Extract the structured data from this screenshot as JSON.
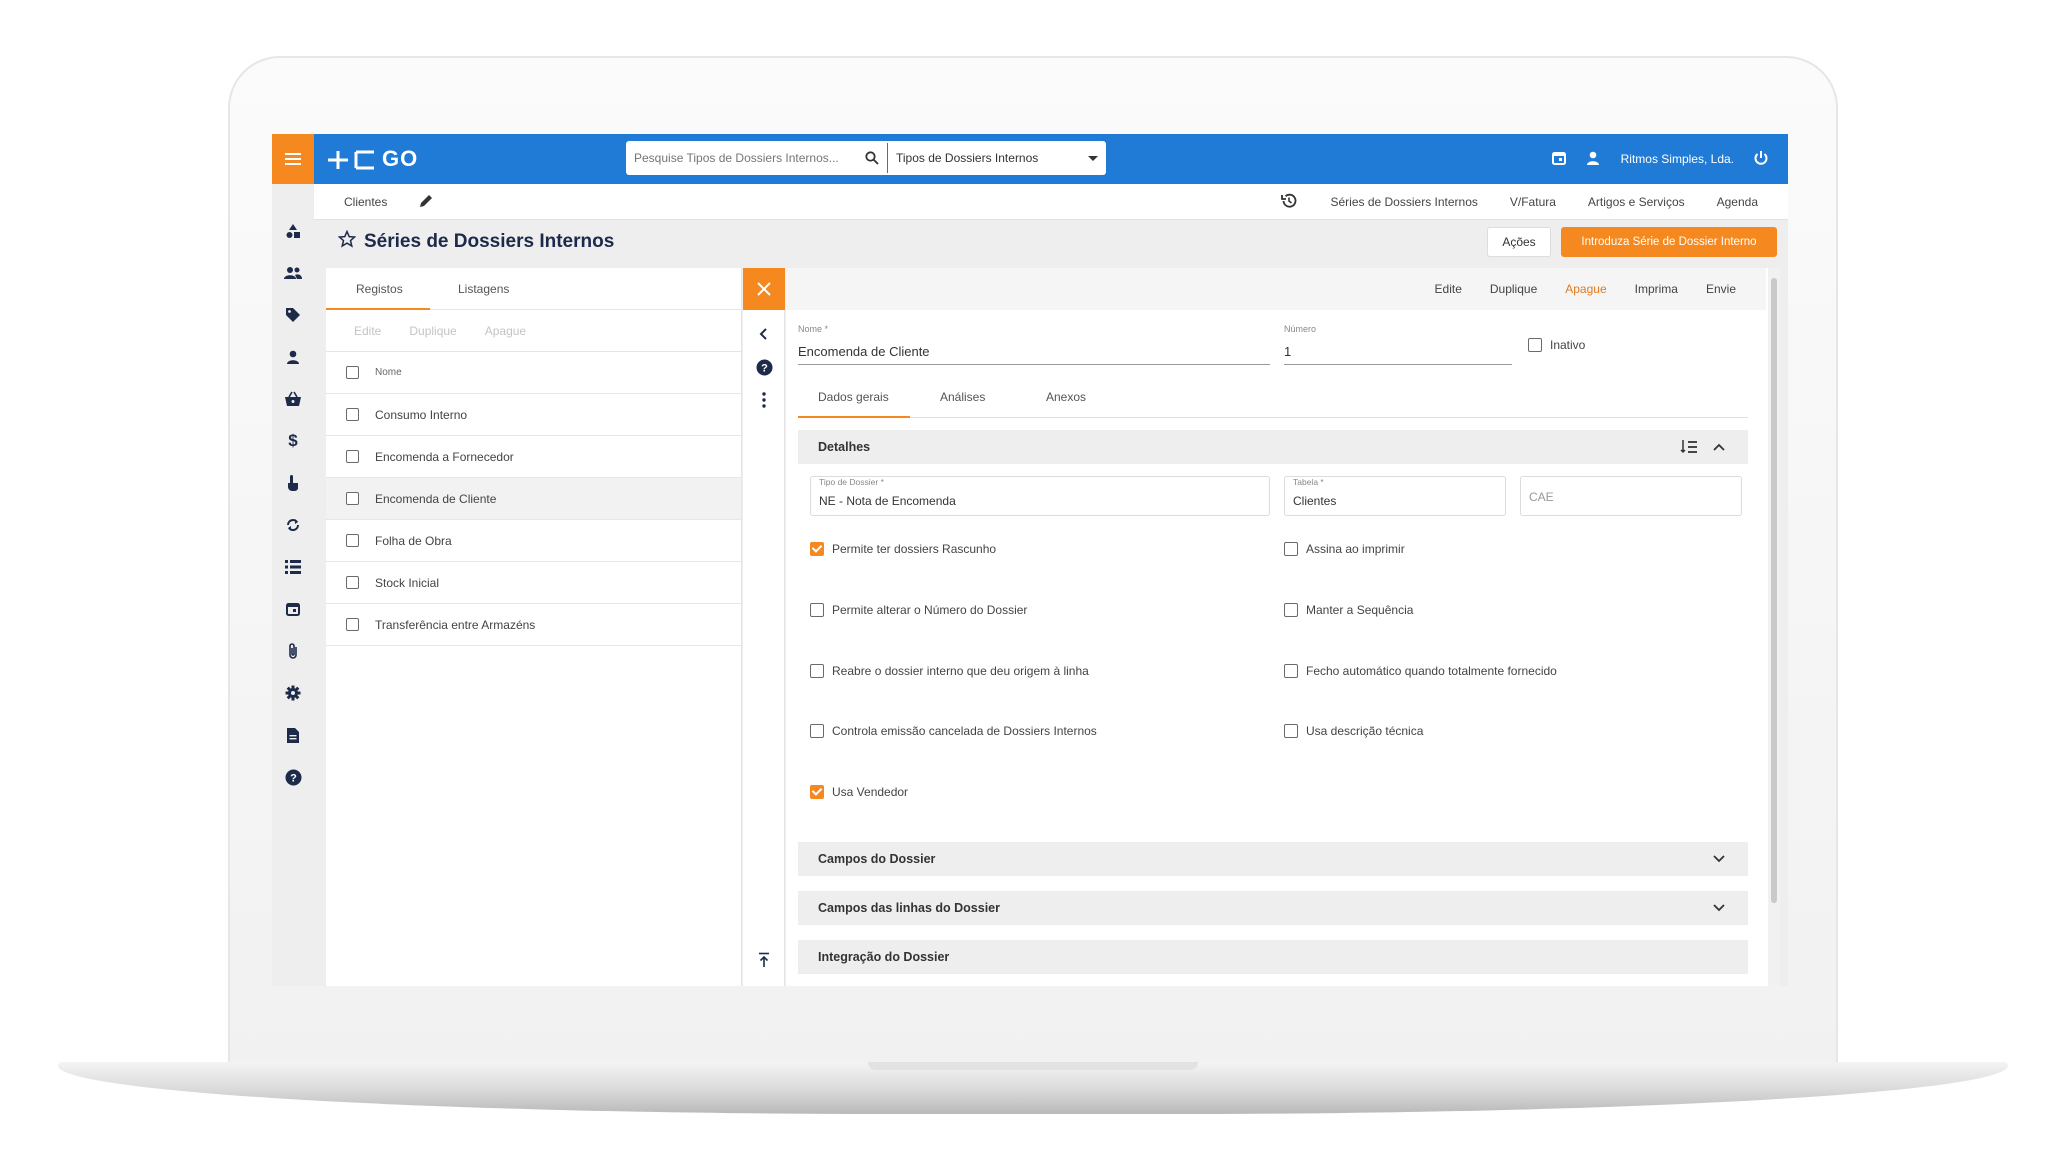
{
  "app": {
    "logo_text": "GO",
    "company": "Ritmos Simples, Lda."
  },
  "search": {
    "placeholder": "Pesquise Tipos de Dossiers Internos...",
    "scope": "Tipos de Dossiers Internos"
  },
  "breadcrumb": {
    "label": "Clientes"
  },
  "quick_links": [
    "Séries de Dossiers Internos",
    "V/Fatura",
    "Artigos e Serviços",
    "Agenda"
  ],
  "page": {
    "title": "Séries de Dossiers Internos",
    "actions_label": "Ações",
    "new_label": "Introduza Série de Dossier Interno"
  },
  "left_nav": [
    "shapes-icon",
    "users-icon",
    "tag-icon",
    "person-icon",
    "basket-icon",
    "dollar-icon",
    "hand-pointer-icon",
    "sync-icon",
    "list-icon",
    "calendar-icon",
    "paperclip-icon",
    "gear-icon",
    "document-icon",
    "help-icon"
  ],
  "list": {
    "tabs": [
      "Registos",
      "Listagens"
    ],
    "actions": [
      "Edite",
      "Duplique",
      "Apague"
    ],
    "column": "Nome",
    "rows": [
      "Consumo Interno",
      "Encomenda a Fornecedor",
      "Encomenda de Cliente",
      "Folha de Obra",
      "Stock Inicial",
      "Transferência entre Armazéns"
    ],
    "selected_index": 2
  },
  "detail": {
    "toolbar": {
      "edit": "Edite",
      "duplicate": "Duplique",
      "delete": "Apague",
      "print": "Imprima",
      "send": "Envie"
    },
    "nome": {
      "label": "Nome *",
      "value": "Encomenda de Cliente"
    },
    "numero": {
      "label": "Número",
      "value": "1"
    },
    "inativo": {
      "label": "Inativo",
      "checked": false
    },
    "tabs": [
      "Dados gerais",
      "Análises",
      "Anexos"
    ],
    "sections": {
      "detalhes": "Detalhes",
      "campos_dossier": "Campos do Dossier",
      "campos_linhas": "Campos das linhas do Dossier",
      "integracao": "Integração do Dossier"
    },
    "tipo_dossier": {
      "label": "Tipo de Dossier *",
      "value": "NE - Nota de Encomenda"
    },
    "tabela": {
      "label": "Tabela *",
      "value": "Clientes"
    },
    "cae": {
      "placeholder": "CAE"
    },
    "options": [
      {
        "label": "Permite ter dossiers Rascunho",
        "checked": true
      },
      {
        "label": "Assina ao imprimir",
        "checked": false
      },
      {
        "label": "Permite alterar o Número do Dossier",
        "checked": false
      },
      {
        "label": "Manter a Sequência",
        "checked": false
      },
      {
        "label": "Reabre o dossier interno que deu origem à linha",
        "checked": false
      },
      {
        "label": "Fecho automático quando totalmente fornecido",
        "checked": false
      },
      {
        "label": "Controla emissão cancelada de Dossiers Internos",
        "checked": false
      },
      {
        "label": "Usa descrição técnica",
        "checked": false
      },
      {
        "label": "Usa Vendedor",
        "checked": true
      }
    ]
  },
  "colors": {
    "primary": "#1f7bd6",
    "accent": "#f5891f",
    "nav_icon": "#1d2a4a"
  }
}
